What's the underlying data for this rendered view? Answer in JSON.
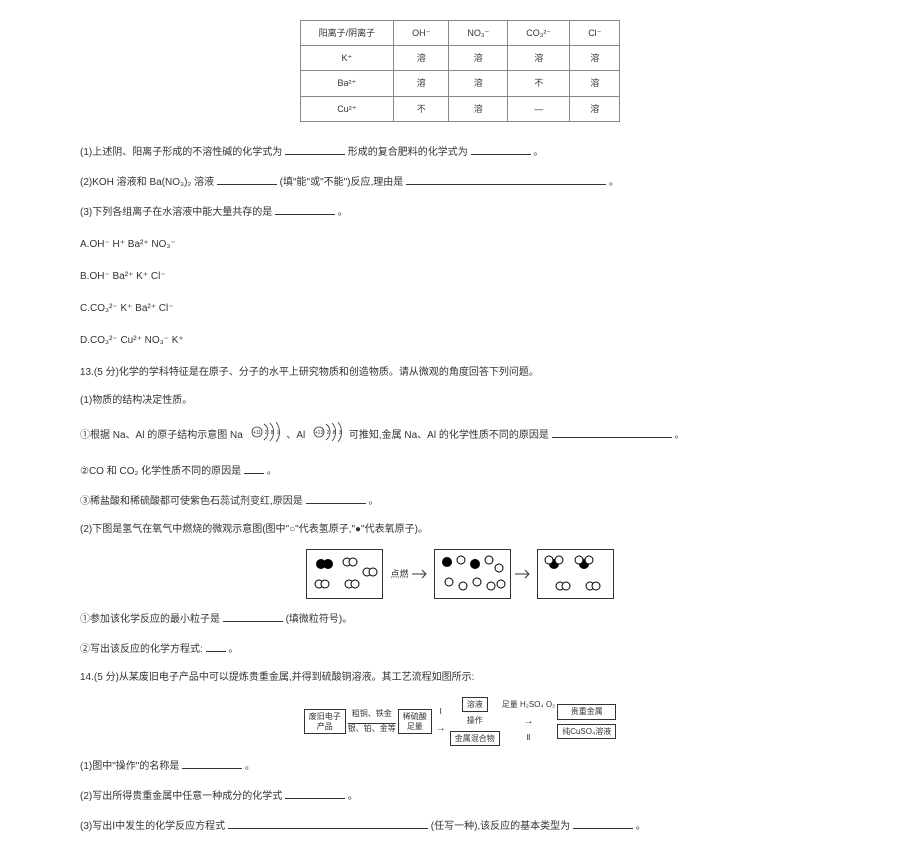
{
  "table": {
    "header_row": [
      "阳离子/阴离子",
      "OH⁻",
      "NO₃⁻",
      "CO₃²⁻",
      "Cl⁻"
    ],
    "rows": [
      [
        "K⁺",
        "溶",
        "溶",
        "溶",
        "溶"
      ],
      [
        "Ba²⁺",
        "溶",
        "溶",
        "不",
        "溶"
      ],
      [
        "Cu²⁺",
        "不",
        "溶",
        "—",
        "溶"
      ]
    ]
  },
  "q1": "(1)上述阴、阳离子形成的不溶性碱的化学式为",
  "q1b": "形成的复合肥料的化学式为",
  "q1c": "。",
  "q2a": "(2)KOH 溶液和 Ba(NO₃)₂ 溶液",
  "q2b": "(填\"能\"或\"不能\")反应,理由是",
  "q2c": "。",
  "q3": "(3)下列各组离子在水溶液中能大量共存的是",
  "q3end": "。",
  "optA": "A.OH⁻   H⁺   Ba²⁺   NO₃⁻",
  "optB": "B.OH⁻   Ba²⁺   K⁺   Cl⁻",
  "optC": "C.CO₃²⁻   K⁺   Ba²⁺   Cl⁻",
  "optD": "D.CO₃²⁻   Cu²⁺   NO₃⁻   K⁺",
  "q13": "13.(5 分)化学的学科特征是在原子、分子的水平上研究物质和创造物质。请从微观的角度回答下列问题。",
  "q13_1": "(1)物质的结构决定性质。",
  "q13_1_1a": "①根据 Na、Al 的原子结构示意图 Na",
  "q13_1_1b": "、Al",
  "q13_1_1c": " 可推知,金属 Na、Al 的化学性质不同的原因是",
  "q13_1_1d": "。",
  "q13_1_2a": "②CO 和 CO₂ 化学性质不同的原因是",
  "q13_1_2b": "。",
  "q13_1_3a": "③稀盐酸和稀硫酸都可使紫色石蕊试剂变红,原因是",
  "q13_1_3b": "。",
  "q13_2": "(2)下图是氢气在氧气中燃烧的微观示意图(图中\"○\"代表氢原子,\"●\"代表氧原子)。",
  "diagram_label": "点燃",
  "q13_2_1a": "①参加该化学反应的最小粒子是",
  "q13_2_1b": "(填微粒符号)。",
  "q13_2_2a": "②写出该反应的化学方程式:",
  "q13_2_2b": "。",
  "q14": "14.(5 分)从某废旧电子产品中可以提炼贵重金属,并得到硫酸铜溶液。其工艺流程如图所示:",
  "flow": {
    "box1": "废旧电子\n产品",
    "lbl1a": "粗铜、铁金",
    "lbl1b": "银、铂、金等",
    "box2": "稀硫酸\n足量",
    "op_a": "Ⅰ",
    "box3": "溶液",
    "op_b": "操作",
    "box4": "金属混合物",
    "lbl4": "足量 H₂SO₄ O₂",
    "op_c": "Ⅱ",
    "box5": "贵重金属",
    "box6": "纯CuSO₄溶液"
  },
  "q14_1a": "(1)图中\"操作\"的名称是",
  "q14_1b": "。",
  "q14_2a": "(2)写出所得贵重金属中任意一种成分的化学式",
  "q14_2b": "。",
  "q14_3a": "(3)写出Ⅰ中发生的化学反应方程式",
  "q14_3b": "(任写一种),该反应的基本类型为",
  "q14_3c": "。"
}
